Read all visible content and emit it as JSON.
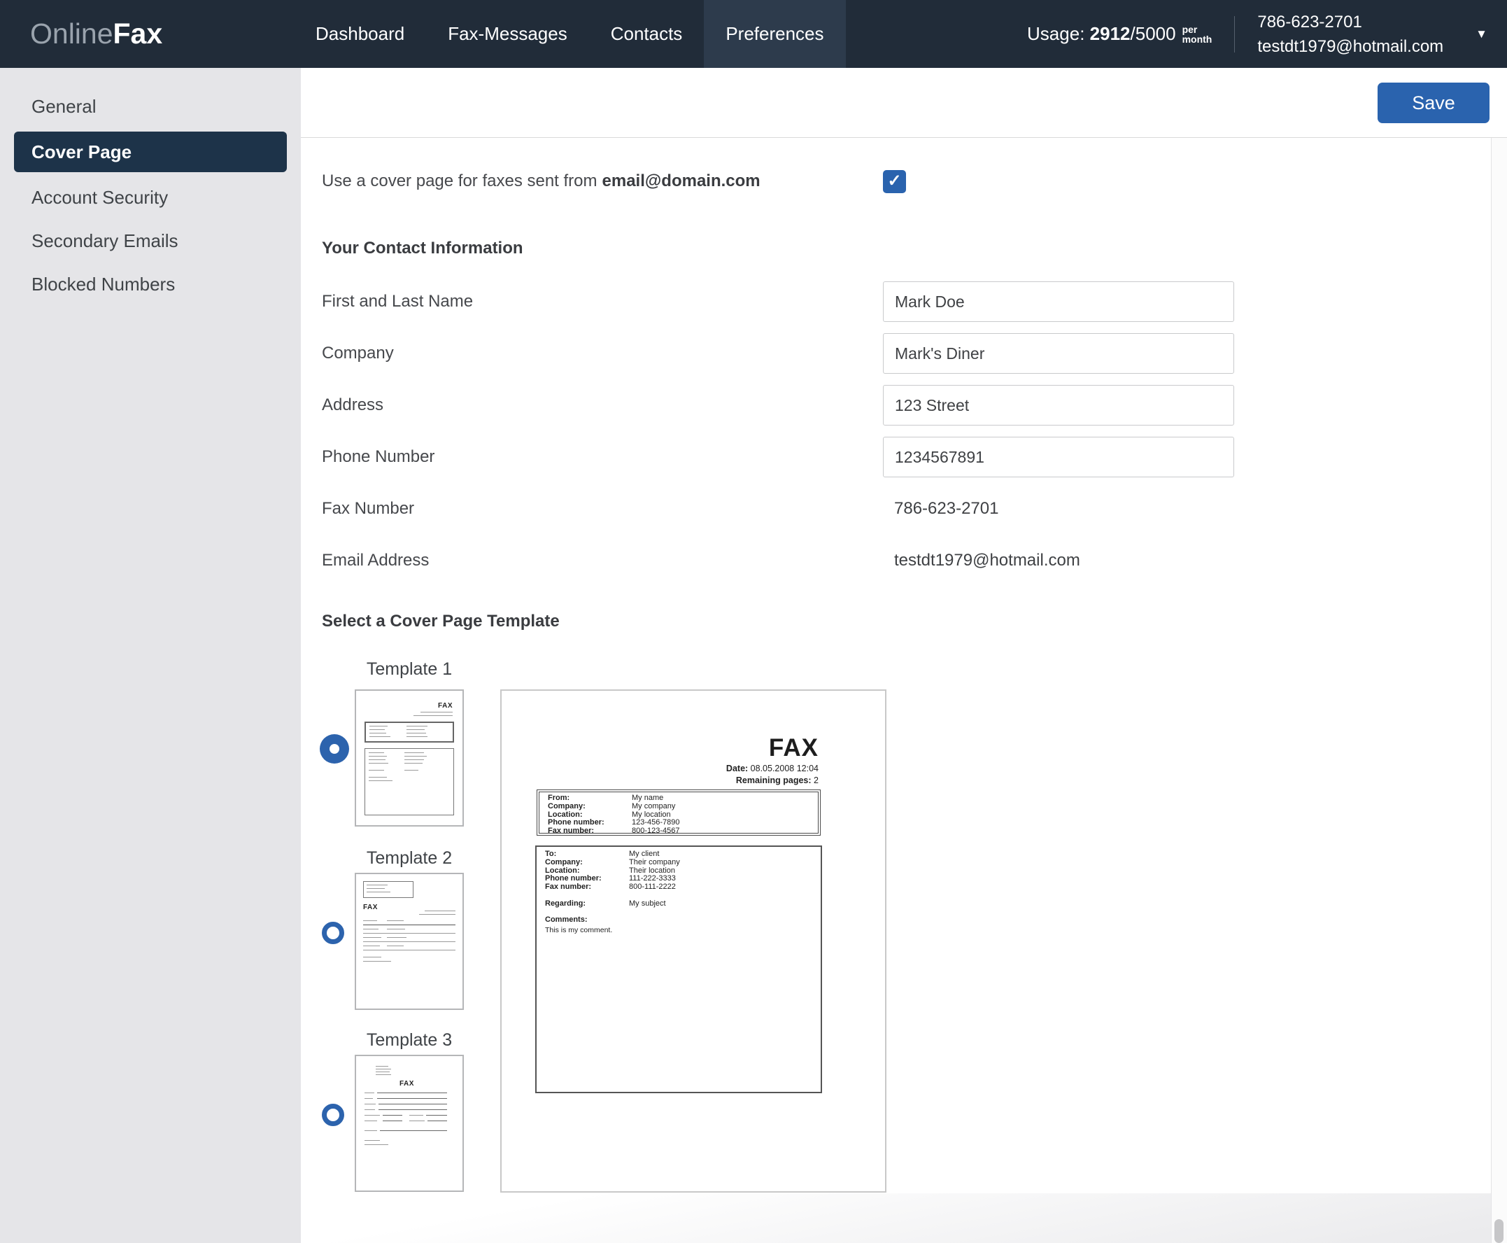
{
  "header": {
    "logo": {
      "part1": "Online",
      "part2": "Fax"
    },
    "nav": [
      {
        "label": "Dashboard",
        "active": false
      },
      {
        "label": "Fax-Messages",
        "active": false
      },
      {
        "label": "Contacts",
        "active": false
      },
      {
        "label": "Preferences",
        "active": true
      }
    ],
    "usage": {
      "label": "Usage:",
      "used": "2912",
      "sep": "/",
      "total": "5000",
      "per": "per",
      "month": "month"
    },
    "phone": "786-623-2701",
    "email": "testdt1979@hotmail.com",
    "caret": "▼"
  },
  "sidebar": {
    "items": [
      {
        "label": "General",
        "active": false
      },
      {
        "label": "Cover Page",
        "active": true
      },
      {
        "label": "Account Security",
        "active": false
      },
      {
        "label": "Secondary Emails",
        "active": false
      },
      {
        "label": "Blocked Numbers",
        "active": false
      }
    ]
  },
  "toolbar": {
    "save_label": "Save"
  },
  "cover_toggle": {
    "text": "Use a cover page for faxes sent from",
    "email_bold": "email@domain.com",
    "checked": true,
    "check_glyph": "✓"
  },
  "contact_info": {
    "heading": "Your Contact Information",
    "fields": [
      {
        "label": "First and Last Name",
        "value": "Mark Doe",
        "type": "input"
      },
      {
        "label": "Company",
        "value": "Mark's Diner",
        "type": "input"
      },
      {
        "label": "Address",
        "value": "123 Street",
        "type": "input"
      },
      {
        "label": "Phone Number",
        "value": "1234567891",
        "type": "input"
      },
      {
        "label": "Fax Number",
        "value": "786-623-2701",
        "type": "text"
      },
      {
        "label": "Email Address",
        "value": "testdt1979@hotmail.com",
        "type": "text"
      }
    ]
  },
  "templates": {
    "heading": "Select a Cover Page Template",
    "options": [
      {
        "label": "Template 1",
        "selected": true
      },
      {
        "label": "Template 2",
        "selected": false
      },
      {
        "label": "Template 3",
        "selected": false
      }
    ]
  },
  "preview": {
    "title": "FAX",
    "date_label": "Date:",
    "date_value": "08.05.2008 12:04",
    "remaining_label": "Remaining pages:",
    "remaining_value": "2",
    "from_rows": [
      {
        "label": "From:",
        "value": "My name"
      },
      {
        "label": "Company:",
        "value": "My company"
      },
      {
        "label": "Location:",
        "value": "My location"
      },
      {
        "label": "Phone number:",
        "value": "123-456-7890"
      },
      {
        "label": "Fax number:",
        "value": "800-123-4567"
      }
    ],
    "to_rows": [
      {
        "label": "To:",
        "value": "My client"
      },
      {
        "label": "Company:",
        "value": "Their company"
      },
      {
        "label": "Location:",
        "value": "Their location"
      },
      {
        "label": "Phone number:",
        "value": "111-222-3333"
      },
      {
        "label": "Fax number:",
        "value": "800-111-2222"
      }
    ],
    "regarding_label": "Regarding:",
    "regarding_value": "My subject",
    "comments_label": "Comments:",
    "comments_value": "This is my comment."
  },
  "colors": {
    "navbar_bg": "#212c39",
    "nav_active_bg": "#2d3b4c",
    "sidebar_bg": "#e5e5e8",
    "sidebar_active_bg": "#1d3349",
    "accent_blue": "#2a63ae",
    "radio_blue": "#2c63ad"
  }
}
